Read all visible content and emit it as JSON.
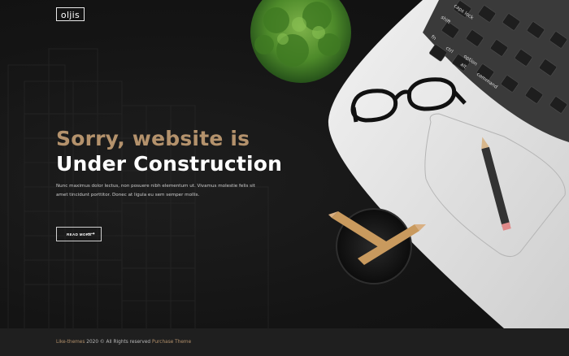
{
  "brand": {
    "logo_text": "oljis"
  },
  "hero": {
    "headline_line1": "Sorry, website is",
    "headline_line2": "Under Construction",
    "description": "Nunc maximus dolor lectus, non posuere nibh elementum ut. Vivamus molestie felis sit amet tincidunt porttitor. Donec at ligula eu sem semper mollis.",
    "button_label": "READ MORE",
    "button_arrow": "⟶"
  },
  "keyboard": {
    "keys": [
      "caps lock",
      "shift",
      "fn",
      "ctrl",
      "option",
      "alt",
      "command"
    ]
  },
  "footer": {
    "brand_link": "Like-themes",
    "copyright": "2020 © All Rights reserved",
    "purchase_link": "Purchase Theme"
  },
  "colors": {
    "background": "#161616",
    "accent_gold": "#b4926c",
    "footer_bg": "#1f1f1f",
    "text_white": "#ffffff"
  }
}
